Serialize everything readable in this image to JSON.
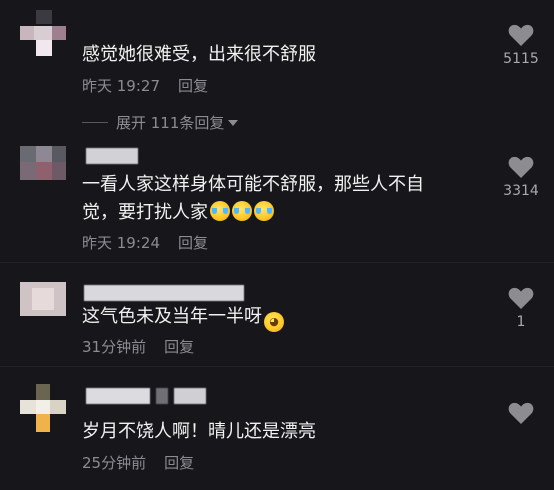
{
  "colors": {
    "background": "#17171b",
    "text_primary": "#f1f1f1",
    "text_secondary": "#8b8b91",
    "like_icon": "#8c8c91"
  },
  "comments": [
    {
      "text": "感觉她很难受，出来很不舒服",
      "time": "昨天 19:27",
      "reply": "回复",
      "likes": "5115",
      "expand": "展开 111条回复"
    },
    {
      "text_line1": "一看人家这样身体可能不舒服，那些人不自",
      "text_line2": "觉，要打扰人家",
      "emoji_icons": [
        "rolling-laugh-emoji",
        "rolling-laugh-emoji",
        "rolling-laugh-emoji"
      ],
      "time": "昨天 19:24",
      "reply": "回复",
      "likes": "3314"
    },
    {
      "text": "这气色未及当年一半呀",
      "emoji_icons": [
        "pleading-emoji"
      ],
      "time": "31分钟前",
      "reply": "回复",
      "likes": "1"
    },
    {
      "text": "岁月不饶人啊！晴儿还是漂亮",
      "time": "25分钟前",
      "reply": "回复",
      "likes": ""
    }
  ]
}
